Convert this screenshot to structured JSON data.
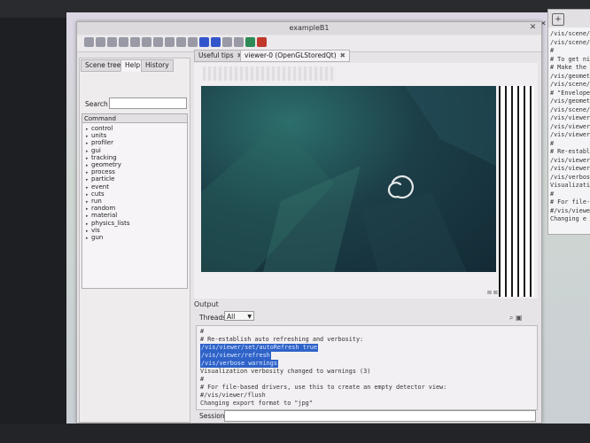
{
  "window": {
    "title": "exampleB1"
  },
  "toolbar": {
    "icons": [
      "open-icon",
      "save-icon",
      "gear-icon",
      "move-icon",
      "crosshair-icon",
      "zoom-in-icon",
      "zoom-out-icon",
      "rotate-icon",
      "surface-icon",
      "hidden-line-icon",
      "wireframe-icon",
      "solid-icon",
      "perspective-icon",
      "ortho-icon",
      "run-icon",
      "stop-icon"
    ]
  },
  "left_dock": {
    "tabs": [
      "Scene tree",
      "Help",
      "History"
    ],
    "search_label": "Search :",
    "command_header": "Command",
    "commands": [
      "control",
      "units",
      "profiler",
      "gui",
      "tracking",
      "geometry",
      "process",
      "particle",
      "event",
      "cuts",
      "run",
      "random",
      "material",
      "physics_lists",
      "vis",
      "gun"
    ]
  },
  "viewer_tabs": [
    {
      "label": "Useful tips",
      "close": "✖"
    },
    {
      "label": "viewer-0 (OpenGLStoredQt)",
      "close": "✖"
    }
  ],
  "output": {
    "title": "Output",
    "threads_label": "Threads:",
    "threads_value": "All",
    "lines": [
      {
        "text": "#",
        "hl": false
      },
      {
        "text": "# Re-establish auto refreshing and verbosity:",
        "hl": false
      },
      {
        "text": "/vis/viewer/set/autoRefresh true",
        "hl": true
      },
      {
        "text": "/vis/viewer/refresh",
        "hl": true
      },
      {
        "text": "/vis/verbose warnings",
        "hl": true
      },
      {
        "text": "Visualization verbosity changed to warnings (3)",
        "hl": false
      },
      {
        "text": "#",
        "hl": false
      },
      {
        "text": "# For file-based drivers, use this to create an empty detector view:",
        "hl": false
      },
      {
        "text": "#/vis/viewer/flush",
        "hl": false
      },
      {
        "text": " Changing export format to \"jpg\"",
        "hl": false
      }
    ],
    "session_label": "Session :"
  },
  "terminal": {
    "lines": [
      "/vis/scene/",
      "/vis/scene/",
      "#",
      "# To get ni",
      "# Make the",
      "/vis/geomet",
      "/vis/scene/",
      "# \"Envelope",
      "/vis/geomet",
      "/vis/scene/",
      "/vis/viewer",
      "/vis/viewer",
      "/vis/viewer",
      "#",
      "# Re-establ",
      "/vis/viewer",
      "/vis/viewer",
      "/vis/verbos",
      "Visualizatio",
      "#",
      "# For file-",
      "#/vis/viewer",
      " Changing e"
    ]
  },
  "colors": {
    "highlight": "#2f63c8",
    "canvas": "#1c3e47"
  }
}
